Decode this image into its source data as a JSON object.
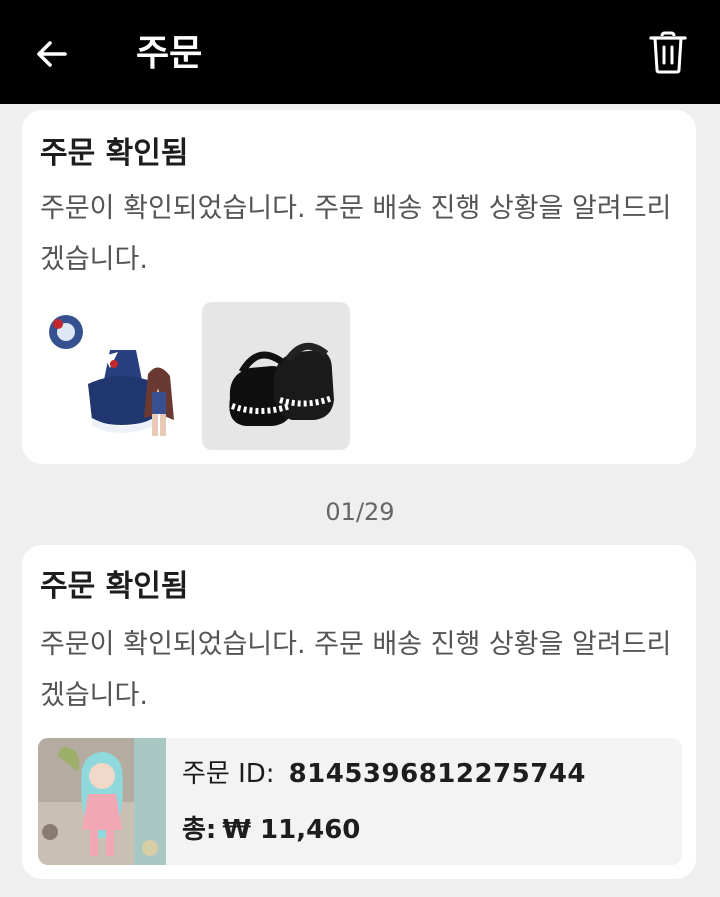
{
  "header": {
    "title": "주문",
    "back_icon": "arrow-left-icon",
    "delete_icon": "trash-icon"
  },
  "notifications": [
    {
      "title": "주문 확인됨",
      "message": "주문이 확인되었습니다. 주문 배송 진행 상황을 알려드리겠습니다.",
      "products": [
        "doll-outfit-thumbnail",
        "doll-shoes-thumbnail"
      ]
    },
    {
      "title": "주문 확인됨",
      "message": "주문이 확인되었습니다. 주문 배송 진행 상황을 알려드리겠습니다.",
      "order": {
        "id_label": "주문 ID:",
        "id": "8145396812275744",
        "total_label": "총:",
        "total": "₩ 11,460"
      }
    }
  ],
  "date_separator": "01/29"
}
